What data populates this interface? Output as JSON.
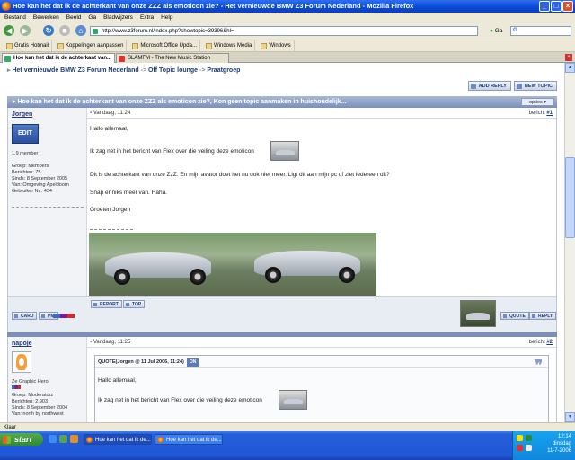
{
  "window": {
    "title": "Hoe kan het dat ik de achterkant van onze ZZZ als emoticon zie? - Het vernieuwde BMW Z3 Forum Nederland - Mozilla Firefox"
  },
  "menu": [
    "Bestand",
    "Bewerken",
    "Beeld",
    "Ga",
    "Bladwijzers",
    "Extra",
    "Help"
  ],
  "nav": {
    "url": "http://www.z3forum.nl/index.php?showtopic=39396&hl=",
    "go_label": "Ga",
    "search_engine_label": "G"
  },
  "bookmarks": [
    "Gratis Hotmail",
    "Koppelingen aanpassen",
    "Microsoft Office Upda...",
    "Windows Media",
    "Windows"
  ],
  "tabs": [
    {
      "label": "Hoe kan het dat ik de achterkant van..."
    },
    {
      "label": "SLAMFM - The New Music Station"
    }
  ],
  "breadcrumb": [
    "Het vernieuwde BMW Z3 Forum Nederland",
    "Off Topic lounge",
    "Praatgroep"
  ],
  "breadcrumb_sep": "->",
  "buttons": {
    "add_reply": "ADD REPLY",
    "new_topic": "NEW TOPIC",
    "opties": "opties"
  },
  "topic_title": "Hoe kan het dat ik de achterkant van onze ZZZ als emoticon zie?, Kon geen topic aanmaken in huishoudelijk...",
  "posts": [
    {
      "user": "Jorgen",
      "edit_label": "EDIT",
      "rank": "1.9 member",
      "info": [
        "Groep: Members",
        "Berichten: 75",
        "Sinds: 8 September 2005",
        "Van: Omgeving Apeldoorn",
        "Gebruiker Nr.: 434"
      ],
      "date": "Vandaag, 11:24",
      "number_prefix": "bericht ",
      "number": "#1",
      "lines": [
        "Hallo allemaal,",
        "Ik zag net in het bericht van Flex over die veiling deze emoticon",
        "Dit is de achterkant van onze ZzZ. En mijn avator doet het nu ook niet meer. Ligt dit aan mijn pc of ziet iedereen dit?",
        "Snap er niks meer van. Haha.",
        "Groeten Jorgen"
      ],
      "foot_buttons": {
        "card": "CARD",
        "pm": "PM",
        "report": "REPORT",
        "top": "TOP",
        "quote": "QUOTE",
        "reply": "REPLY"
      }
    },
    {
      "user": "napoje",
      "rank": "Ze Graphic Hero",
      "info": [
        "Groep: Moderatorz",
        "Berichten: 2.903",
        "Sinds: 8 September 2004",
        "Van: north by northwest"
      ],
      "date": "Vandaag, 11:25",
      "number_prefix": "bericht ",
      "number": "#2",
      "quote_head": "QUOTE(Jorgen @ 11 Jul 2006, 11:24)",
      "quote_on": "ON",
      "quote_lines": [
        "Hallo allemaal,",
        "Ik zag net in het bericht van Flex over die veiling deze emoticon"
      ]
    }
  ],
  "status": "Klaar",
  "taskbar": {
    "start": "start",
    "tasks": [
      "Hoe kan het dat ik de...",
      "Hoe kan het dat ik de..."
    ],
    "clock_time": "12:14",
    "clock_day": "dinsdag",
    "clock_date": "11-7-2006"
  }
}
